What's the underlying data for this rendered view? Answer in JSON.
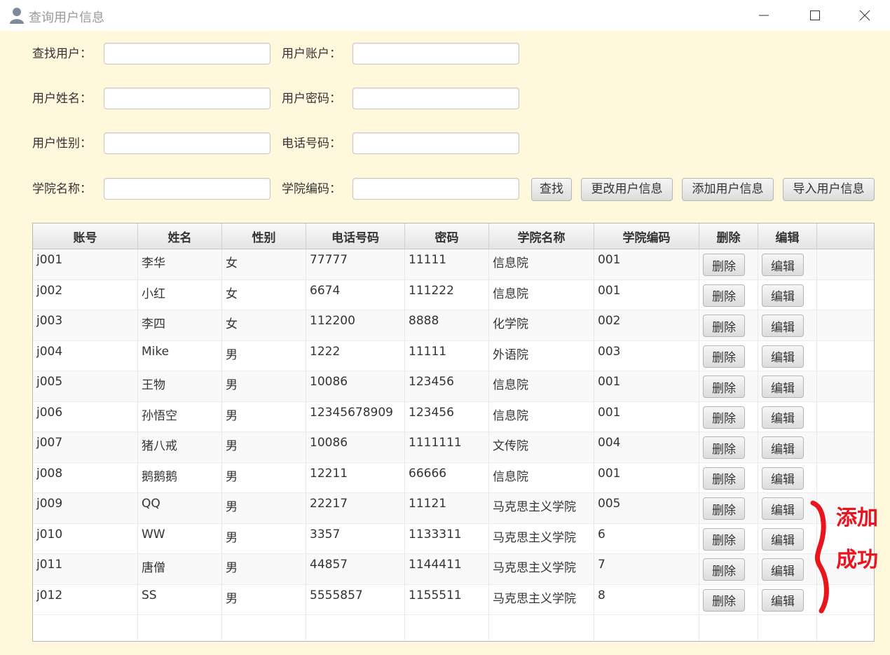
{
  "window": {
    "title": "查询用户信息",
    "icon": "user-icon"
  },
  "form": {
    "find_user_label": "查找用户：",
    "account_label": "用户账户：",
    "name_label": "用户姓名：",
    "password_label": "用户密码：",
    "gender_label": "用户性别：",
    "phone_label": "电话号码：",
    "college_name_label": "学院名称：",
    "college_code_label": "学院编码："
  },
  "toolbar": {
    "search": "查找",
    "update": "更改用户信息",
    "add": "添加用户信息",
    "import": "导入用户信息"
  },
  "table": {
    "headers": [
      "账号",
      "姓名",
      "性别",
      "电话号码",
      "密码",
      "学院名称",
      "学院编码",
      "删除",
      "编辑"
    ],
    "delete_label": "删除",
    "edit_label": "编辑",
    "rows": [
      [
        "j001",
        "李华",
        "女",
        "77777",
        "11111",
        "信息院",
        "001"
      ],
      [
        "j002",
        "小红",
        "女",
        "6674",
        "111222",
        "信息院",
        "001"
      ],
      [
        "j003",
        "李四",
        "女",
        "112200",
        "8888",
        "化学院",
        "002"
      ],
      [
        "j004",
        "Mike",
        "男",
        "1222",
        "11111",
        "外语院",
        "003"
      ],
      [
        "j005",
        "王物",
        "男",
        "10086",
        "123456",
        "信息院",
        "001"
      ],
      [
        "j006",
        "孙悟空",
        "男",
        "12345678909",
        "123456",
        "信息院",
        "001"
      ],
      [
        "j007",
        "猪八戒",
        "男",
        "10086",
        "1111111",
        "文传院",
        "004"
      ],
      [
        "j008",
        "鹅鹅鹅",
        "男",
        "12211",
        "66666",
        "信息院",
        "001"
      ],
      [
        "j009",
        "QQ",
        "男",
        "22217",
        "11121",
        "马克思主义学院",
        "005"
      ],
      [
        "j010",
        "WW",
        "男",
        "3357",
        "1133311",
        "马克思主义学院",
        "6"
      ],
      [
        "j011",
        "唐僧",
        "男",
        "44857",
        "1144411",
        "马克思主义学院",
        "7"
      ],
      [
        "j012",
        "SS",
        "男",
        "5555857",
        "1155511",
        "马克思主义学院",
        "8"
      ]
    ]
  },
  "annotation": {
    "line1": "添加",
    "line2": "成功",
    "color": "#e8141e"
  }
}
